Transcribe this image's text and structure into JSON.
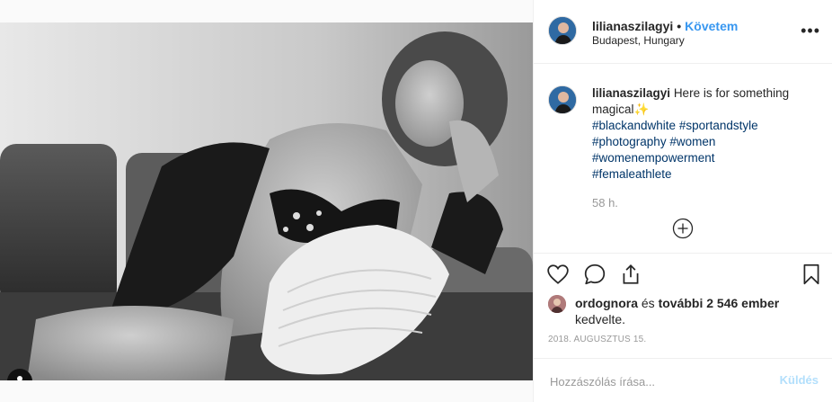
{
  "post": {
    "image_alt": "black-and-white photo of a woman reclining on a sofa",
    "tagged_users_icon": "person-icon"
  },
  "header": {
    "username": "lilianaszilagyi",
    "separator": "•",
    "follow_label": "Követem",
    "location": "Budapest, Hungary",
    "more_label": "•••"
  },
  "caption": {
    "username": "lilianaszilagyi",
    "text": "Here is for something magical",
    "emoji": "✨",
    "hashtags": [
      "#blackandwhite #sportandstyle",
      "#photography #women",
      "#womenempowerment",
      "#femaleathlete"
    ],
    "time_ago": "58 h."
  },
  "actions": {
    "like_icon": "heart-icon",
    "comment_icon": "comment-icon",
    "share_icon": "share-icon",
    "save_icon": "bookmark-icon"
  },
  "likes": {
    "first_user": "ordognora",
    "middle": " és ",
    "others": "további 2 546 ember",
    "line2": "kedvelte."
  },
  "date": "2018. AUGUSZTUS 15.",
  "comment": {
    "placeholder": "Hozzászólás írása...",
    "post_label": "Küldés"
  },
  "colors": {
    "follow_blue": "#3897f0",
    "hashtag_blue": "#003569",
    "post_disabled": "#b2dffc"
  }
}
